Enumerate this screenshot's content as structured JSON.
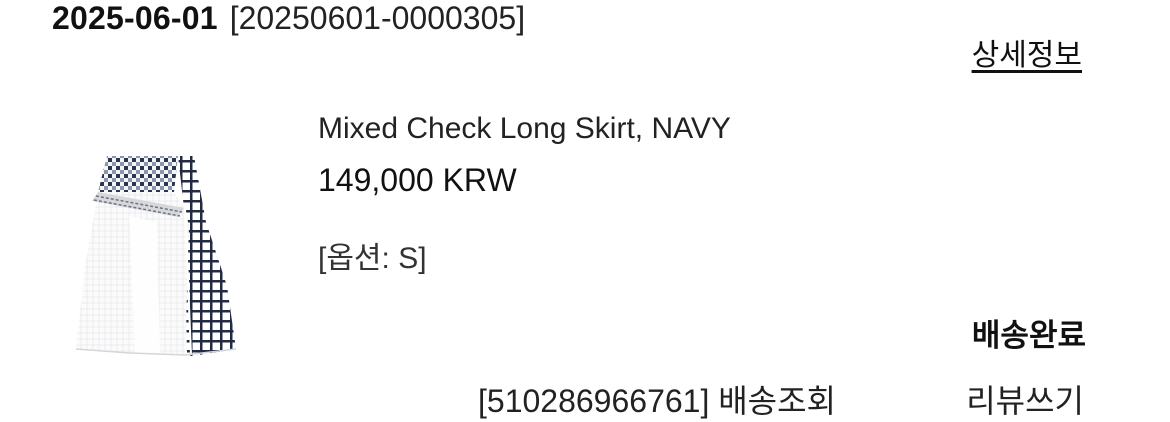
{
  "order": {
    "date": "2025-06-01",
    "number": "[20250601-0000305]",
    "detail_link": "상세정보",
    "status": "배송완료"
  },
  "product": {
    "image_icon": "skirt-product-image",
    "name": "Mixed Check Long Skirt, NAVY",
    "price": "149,000 KRW",
    "option": "[옵션: S]"
  },
  "actions": {
    "tracking": "[510286966761] 배송조회",
    "review": "리뷰쓰기"
  },
  "colors": {
    "text": "#111111",
    "background": "#ffffff",
    "check_navy": "#1f2a44"
  }
}
